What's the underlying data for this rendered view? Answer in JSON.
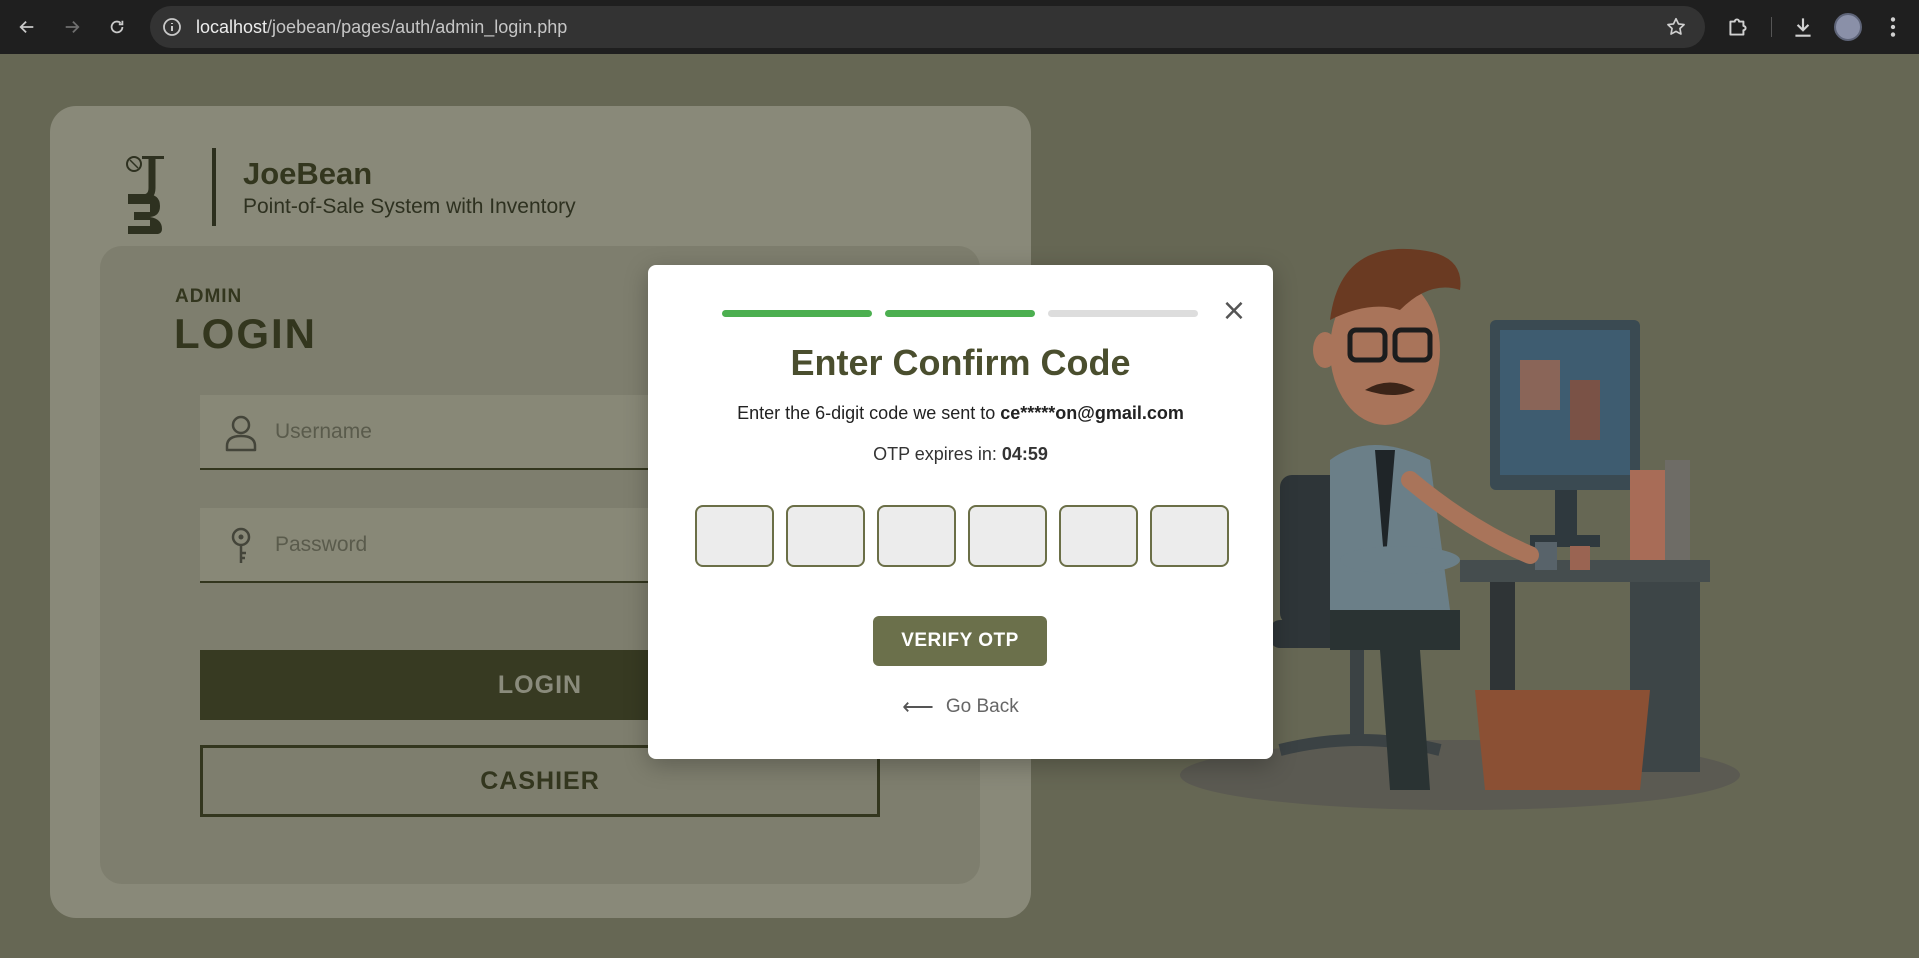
{
  "browser": {
    "url_host": "localhost",
    "url_path": "/joebean/pages/auth/admin_login.php"
  },
  "brand": {
    "name": "JoeBean",
    "subtitle": "Point-of-Sale System with Inventory"
  },
  "login": {
    "role_label": "ADMIN",
    "title": "LOGIN",
    "username_placeholder": "Username",
    "password_placeholder": "Password",
    "login_button": "LOGIN",
    "cashier_button": "CASHIER"
  },
  "modal": {
    "steps": [
      {
        "state": "complete",
        "color": "#4caf50"
      },
      {
        "state": "complete",
        "color": "#4caf50"
      },
      {
        "state": "pending",
        "color": "#dddddd"
      }
    ],
    "close_label": "×",
    "title": "Enter Confirm Code",
    "desc_prefix": "Enter the 6-digit code we sent to ",
    "email_masked": "ce*****on@gmail.com",
    "timer_prefix": "OTP expires in: ",
    "timer_value": "04:59",
    "otp_digits": [
      "",
      "",
      "",
      "",
      "",
      ""
    ],
    "verify_button": "VERIFY OTP",
    "go_back_arrow": "⟵",
    "go_back_label": "Go Back"
  },
  "colors": {
    "accent_olive": "#6b704b",
    "title_olive": "#4a4e2e",
    "progress_done": "#4caf50",
    "overlay_bg": "#666754"
  },
  "icons": {
    "back": "back-arrow-icon",
    "forward": "forward-arrow-icon",
    "reload": "reload-icon",
    "site_info": "info-icon",
    "bookmark": "star-icon",
    "extensions": "puzzle-icon",
    "downloads": "download-icon",
    "menu": "kebab-menu-icon",
    "user_field": "user-icon",
    "password_field": "key-icon"
  }
}
